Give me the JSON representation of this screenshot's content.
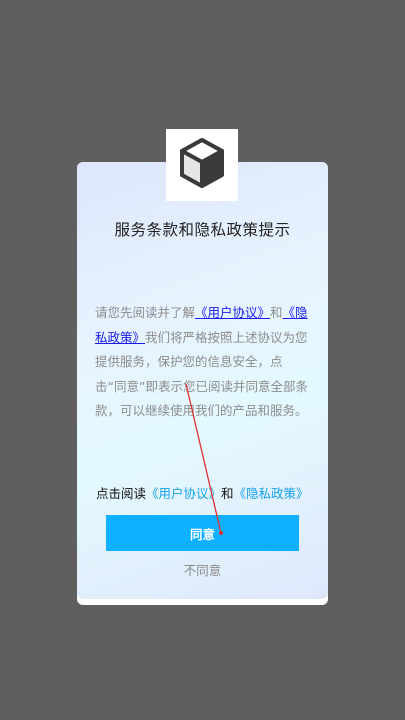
{
  "dialog": {
    "title": "服务条款和隐私政策提示",
    "body_pre": "请您先阅读并了解",
    "user_agreement_link": "《用户协议》",
    "and_text": "和",
    "privacy_policy_link": "《隐私政策》",
    "body_post": "我们将严格按照上述协议为您提供服务，保护您的信息安全，点击“同意”即表示您已阅读并同意全部条款，可以继续使用我们的产品和服务。",
    "footer_prefix": "点击阅读",
    "footer_user_agreement": "《用户协议》",
    "footer_and": "和",
    "footer_privacy_policy": "《隐私政策》",
    "agree_label": "同意",
    "disagree_label": "不同意"
  },
  "logo": {
    "icon": "cube-icon"
  },
  "colors": {
    "backdrop": "#5f5f5f",
    "agree_button": "#0fb0ff",
    "link_blue": "#1a1ae6",
    "footer_link": "#1aa0e8",
    "annotation_line": "#e03030"
  }
}
